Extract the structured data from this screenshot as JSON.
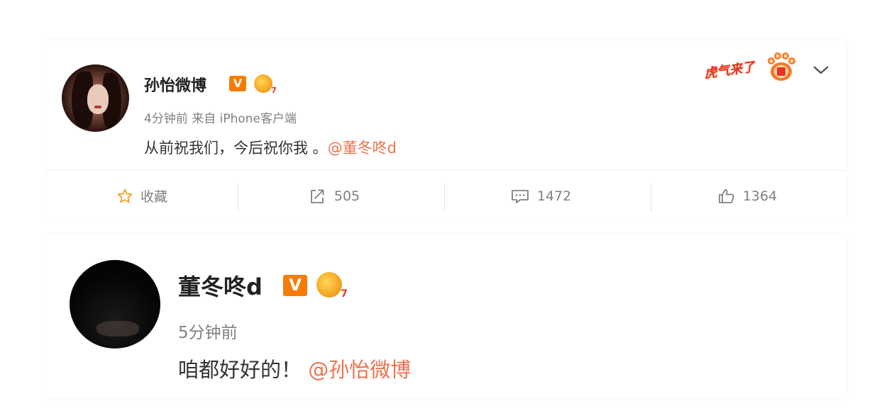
{
  "posts": [
    {
      "username": "孙怡微博",
      "verified_badge": "V",
      "meta": "4分钟前 来自 iPhone客户端",
      "content_text": "从前祝我们，今后祝你我 。",
      "mention": "@董冬咚d",
      "promo_text": "虎气来了",
      "actions": {
        "favorite_label": "收藏",
        "repost_count": "505",
        "comment_count": "1472",
        "like_count": "1364"
      }
    },
    {
      "username": "董冬咚d",
      "verified_badge": "V",
      "meta": "5分钟前",
      "content_text": "咱都好好的！",
      "mention": "@孙怡微博"
    }
  ],
  "colors": {
    "mention": "#eb7350",
    "favorite_icon": "#f0a020",
    "verified_badge": "#f57c00",
    "meta_text": "#808080"
  },
  "icons": [
    "star-icon",
    "repost-icon",
    "comment-icon",
    "like-icon",
    "chevron-down-icon",
    "paw-icon",
    "crown-icon"
  ]
}
